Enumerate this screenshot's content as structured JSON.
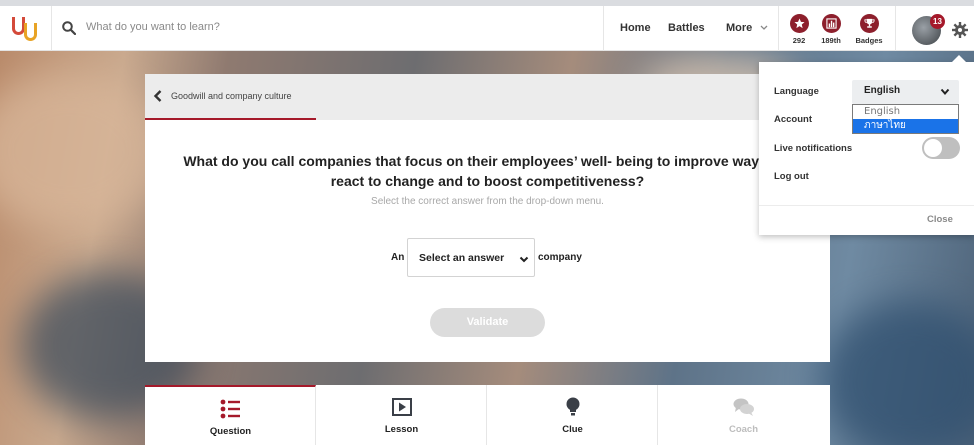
{
  "header": {
    "search_placeholder": "What do you want to learn?",
    "nav": [
      "Home",
      "Battles",
      "More"
    ],
    "stats": [
      {
        "icon": "star-icon",
        "value": "292"
      },
      {
        "icon": "ranking-chart-icon",
        "value": "189th"
      },
      {
        "icon": "trophy-icon",
        "value": "Badges"
      }
    ],
    "notifications_count": "13"
  },
  "card": {
    "breadcrumb": "Goodwill and company culture",
    "question": "What do you call companies that focus on their employees’ well- being to improve way they react to change and to boost competitiveness?",
    "hint": "Select the correct answer from the drop-down menu.",
    "answer_prefix": "An",
    "select_placeholder": "Select an answer",
    "answer_suffix": "company",
    "validate_label": "Validate"
  },
  "tabs": [
    {
      "label": "Question",
      "icon": "list-icon",
      "active": true
    },
    {
      "label": "Lesson",
      "icon": "video-icon",
      "active": false
    },
    {
      "label": "Clue",
      "icon": "lightbulb-icon",
      "active": false
    },
    {
      "label": "Coach",
      "icon": "chat-bubbles-icon",
      "active": false,
      "disabled": true
    }
  ],
  "settings": {
    "language_label": "Language",
    "language_value": "English",
    "language_options": [
      "English",
      "ภาษาไทย"
    ],
    "account_label": "Account",
    "notifications_label": "Live notifications",
    "notifications_on": false,
    "logout_label": "Log out",
    "close_label": "Close"
  },
  "colors": {
    "brand": "#a5192a",
    "highlight": "#1a73e8"
  }
}
